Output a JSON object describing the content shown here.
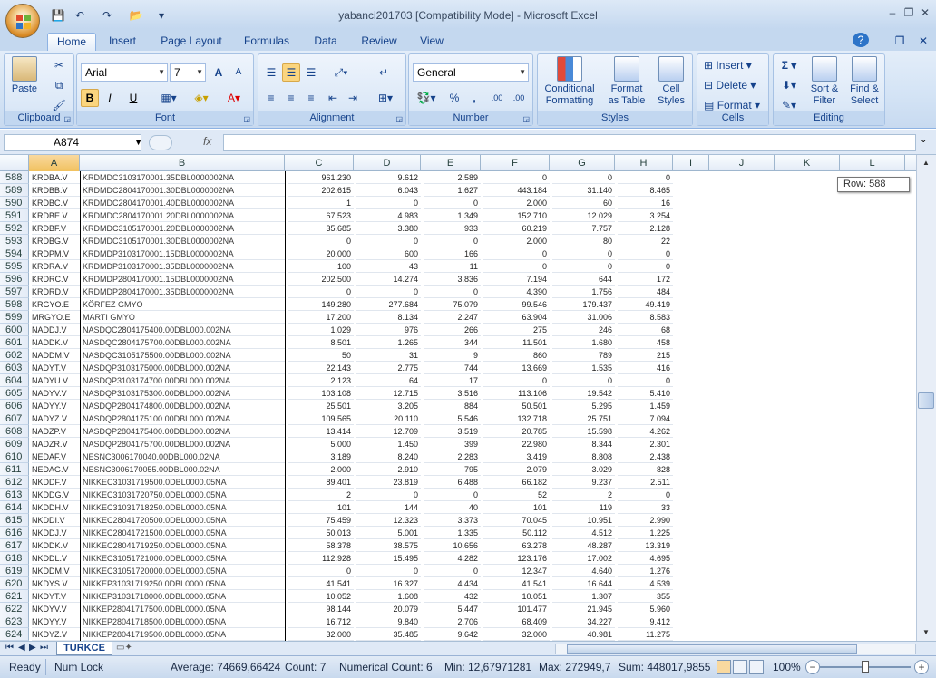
{
  "window": {
    "title": "yabanci201703  [Compatibility Mode] - Microsoft Excel",
    "minimize": "–",
    "restore": "❐",
    "close": "✕"
  },
  "qat": {
    "save": "💾",
    "undo": "↶",
    "redo": "↷",
    "open": "📂",
    "customize": "▾"
  },
  "tabs": [
    "Home",
    "Insert",
    "Page Layout",
    "Formulas",
    "Data",
    "Review",
    "View"
  ],
  "help": "?",
  "ribbon": {
    "clipboard": {
      "label": "Clipboard",
      "paste": "Paste"
    },
    "font": {
      "label": "Font",
      "family": "Arial",
      "size": "7",
      "grow": "A",
      "shrink": "A",
      "bold": "B",
      "italic": "I",
      "underline": "U"
    },
    "alignment": {
      "label": "Alignment"
    },
    "number": {
      "label": "Number",
      "format": "General",
      "percent": "%",
      "comma": ",",
      "inc": ".00",
      "dec": ".00"
    },
    "styles": {
      "label": "Styles",
      "conditional": "Conditional",
      "formatting": "Formatting",
      "format": "Format",
      "as_table": "as Table",
      "cell": "Cell",
      "styles": "Styles"
    },
    "cells": {
      "label": "Cells",
      "insert": "Insert",
      "delete": "Delete",
      "format": "Format"
    },
    "editing": {
      "label": "Editing",
      "sum": "Σ",
      "sort": "Sort &",
      "filter": "Filter",
      "find": "Find &",
      "select": "Select"
    }
  },
  "namebox": "A874",
  "fx": "fx",
  "formula": "",
  "columns": [
    "A",
    "B",
    "C",
    "D",
    "E",
    "F",
    "G",
    "H",
    "I",
    "J",
    "K",
    "L"
  ],
  "rows": [
    [
      "588",
      "KRDBA.V",
      "KRDMDC3103170001.35DBL0000002NA",
      "961.230",
      "9.612",
      "2.589",
      "0",
      "0",
      "0"
    ],
    [
      "589",
      "KRDBB.V",
      "KRDMDC2804170001.30DBL0000002NA",
      "202.615",
      "6.043",
      "1.627",
      "443.184",
      "31.140",
      "8.465"
    ],
    [
      "590",
      "KRDBC.V",
      "KRDMDC2804170001.40DBL0000002NA",
      "1",
      "0",
      "0",
      "2.000",
      "60",
      "16"
    ],
    [
      "591",
      "KRDBE.V",
      "KRDMDC2804170001.20DBL0000002NA",
      "67.523",
      "4.983",
      "1.349",
      "152.710",
      "12.029",
      "3.254"
    ],
    [
      "592",
      "KRDBF.V",
      "KRDMDC3105170001.20DBL0000002NA",
      "35.685",
      "3.380",
      "933",
      "60.219",
      "7.757",
      "2.128"
    ],
    [
      "593",
      "KRDBG.V",
      "KRDMDC3105170001.30DBL0000002NA",
      "0",
      "0",
      "0",
      "2.000",
      "80",
      "22"
    ],
    [
      "594",
      "KRDPM.V",
      "KRDMDP3103170001.15DBL0000002NA",
      "20.000",
      "600",
      "166",
      "0",
      "0",
      "0"
    ],
    [
      "595",
      "KRDRA.V",
      "KRDMDP3103170001.35DBL0000002NA",
      "100",
      "43",
      "11",
      "0",
      "0",
      "0"
    ],
    [
      "596",
      "KRDRC.V",
      "KRDMDP2804170001.15DBL0000002NA",
      "202.500",
      "14.274",
      "3.836",
      "7.194",
      "644",
      "172"
    ],
    [
      "597",
      "KRDRD.V",
      "KRDMDP2804170001.35DBL0000002NA",
      "0",
      "0",
      "0",
      "4.390",
      "1.756",
      "484"
    ],
    [
      "598",
      "KRGYO.E",
      "KÖRFEZ GMYO",
      "149.280",
      "277.684",
      "75.079",
      "99.546",
      "179.437",
      "49.419"
    ],
    [
      "599",
      "MRGYO.E",
      "MARTI GMYO",
      "17.200",
      "8.134",
      "2.247",
      "63.904",
      "31.006",
      "8.583"
    ],
    [
      "600",
      "NADDJ.V",
      "NASDQC2804175400.00DBL000.002NA",
      "1.029",
      "976",
      "266",
      "275",
      "246",
      "68"
    ],
    [
      "601",
      "NADDK.V",
      "NASDQC2804175700.00DBL000.002NA",
      "8.501",
      "1.265",
      "344",
      "11.501",
      "1.680",
      "458"
    ],
    [
      "602",
      "NADDM.V",
      "NASDQC3105175500.00DBL000.002NA",
      "50",
      "31",
      "9",
      "860",
      "789",
      "215"
    ],
    [
      "603",
      "NADYT.V",
      "NASDQP3103175000.00DBL000.002NA",
      "22.143",
      "2.775",
      "744",
      "13.669",
      "1.535",
      "416"
    ],
    [
      "604",
      "NADYU.V",
      "NASDQP3103174700.00DBL000.002NA",
      "2.123",
      "64",
      "17",
      "0",
      "0",
      "0"
    ],
    [
      "605",
      "NADYV.V",
      "NASDQP3103175300.00DBL000.002NA",
      "103.108",
      "12.715",
      "3.516",
      "113.106",
      "19.542",
      "5.410"
    ],
    [
      "606",
      "NADYY.V",
      "NASDQP2804174800.00DBL000.002NA",
      "25.501",
      "3.205",
      "884",
      "50.501",
      "5.295",
      "1.459"
    ],
    [
      "607",
      "NADYZ.V",
      "NASDQP2804175100.00DBL000.002NA",
      "109.565",
      "20.110",
      "5.546",
      "132.718",
      "25.751",
      "7.094"
    ],
    [
      "608",
      "NADZP.V",
      "NASDQP2804175400.00DBL000.002NA",
      "13.414",
      "12.709",
      "3.519",
      "20.785",
      "15.598",
      "4.262"
    ],
    [
      "609",
      "NADZR.V",
      "NASDQP2804175700.00DBL000.002NA",
      "5.000",
      "1.450",
      "399",
      "22.980",
      "8.344",
      "2.301"
    ],
    [
      "610",
      "NEDAF.V",
      "NESNC3006170040.00DBL000.02NA",
      "3.189",
      "8.240",
      "2.283",
      "3.419",
      "8.808",
      "2.438"
    ],
    [
      "611",
      "NEDAG.V",
      "NESNC3006170055.00DBL000.02NA",
      "2.000",
      "2.910",
      "795",
      "2.079",
      "3.029",
      "828"
    ],
    [
      "612",
      "NKDDF.V",
      "NIKKEC31031719500.0DBL0000.05NA",
      "89.401",
      "23.819",
      "6.488",
      "66.182",
      "9.237",
      "2.511"
    ],
    [
      "613",
      "NKDDG.V",
      "NIKKEC31031720750.0DBL0000.05NA",
      "2",
      "0",
      "0",
      "52",
      "2",
      "0"
    ],
    [
      "614",
      "NKDDH.V",
      "NIKKEC31031718250.0DBL0000.05NA",
      "101",
      "144",
      "40",
      "101",
      "119",
      "33"
    ],
    [
      "615",
      "NKDDI.V",
      "NIKKEC28041720500.0DBL0000.05NA",
      "75.459",
      "12.323",
      "3.373",
      "70.045",
      "10.951",
      "2.990"
    ],
    [
      "616",
      "NKDDJ.V",
      "NIKKEC28041721500.0DBL0000.05NA",
      "50.013",
      "5.001",
      "1.335",
      "50.112",
      "4.512",
      "1.225"
    ],
    [
      "617",
      "NKDDK.V",
      "NIKKEC28041719250.0DBL0000.05NA",
      "58.378",
      "38.575",
      "10.656",
      "63.278",
      "48.287",
      "13.319"
    ],
    [
      "618",
      "NKDDL.V",
      "NIKKEC31051721000.0DBL0000.05NA",
      "112.928",
      "15.495",
      "4.282",
      "123.176",
      "17.002",
      "4.695"
    ],
    [
      "619",
      "NKDDM.V",
      "NIKKEC31051720000.0DBL0000.05NA",
      "0",
      "0",
      "0",
      "12.347",
      "4.640",
      "1.276"
    ],
    [
      "620",
      "NKDYS.V",
      "NIKKEP31031719250.0DBL0000.05NA",
      "41.541",
      "16.327",
      "4.434",
      "41.541",
      "16.644",
      "4.539"
    ],
    [
      "621",
      "NKDYT.V",
      "NIKKEP31031718000.0DBL0000.05NA",
      "10.052",
      "1.608",
      "432",
      "10.051",
      "1.307",
      "355"
    ],
    [
      "622",
      "NKDYV.V",
      "NIKKEP28041717500.0DBL0000.05NA",
      "98.144",
      "20.079",
      "5.447",
      "101.477",
      "21.945",
      "5.960"
    ],
    [
      "623",
      "NKDYY.V",
      "NIKKEP28041718500.0DBL0000.05NA",
      "16.712",
      "9.840",
      "2.706",
      "68.409",
      "34.227",
      "9.412"
    ],
    [
      "624",
      "NKDYZ.V",
      "NIKKEP28041719500.0DBL0000.05NA",
      "32.000",
      "35.485",
      "9.642",
      "32.000",
      "40.981",
      "11.275"
    ]
  ],
  "tooltip": "Row: 588",
  "sheet_tab": "TURKCE",
  "status": {
    "ready": "Ready",
    "numlock": "Num Lock",
    "average": "Average: 74669,66424",
    "count": "Count: 7",
    "numcount": "Numerical Count: 6",
    "min": "Min: 12,67971281",
    "max": "Max: 272949,7",
    "sum": "Sum: 448017,9855",
    "zoom": "100%"
  }
}
